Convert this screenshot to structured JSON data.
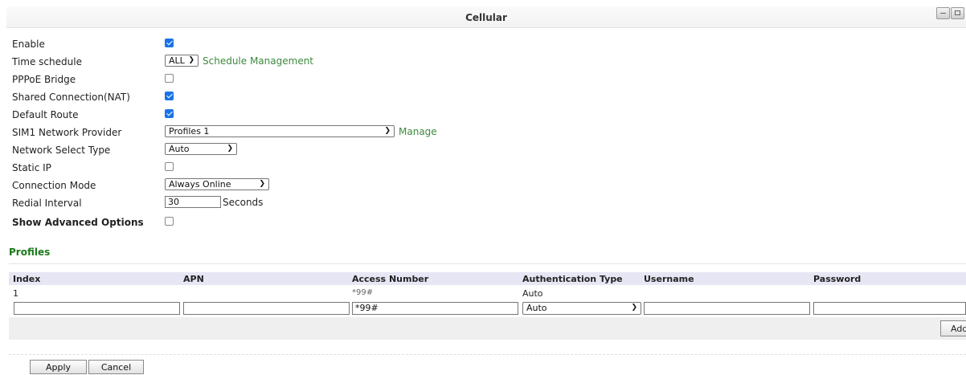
{
  "title": "Cellular",
  "form": {
    "enable_label": "Enable",
    "enable_checked": true,
    "time_schedule_label": "Time schedule",
    "time_schedule_value": "ALL",
    "schedule_management_link": "Schedule Management",
    "pppoe_label": "PPPoE Bridge",
    "pppoe_checked": false,
    "shared_label": "Shared Connection(NAT)",
    "shared_checked": true,
    "default_route_label": "Default Route",
    "default_route_checked": true,
    "sim1_label": "SIM1 Network Provider",
    "sim1_value": "Profiles 1",
    "manage_link": "Manage",
    "net_select_label": "Network Select Type",
    "net_select_value": "Auto",
    "static_ip_label": "Static IP",
    "static_ip_checked": false,
    "conn_mode_label": "Connection Mode",
    "conn_mode_value": "Always Online",
    "redial_label": "Redial Interval",
    "redial_value": "30",
    "redial_unit": "Seconds",
    "advanced_label": "Show Advanced Options",
    "advanced_checked": false
  },
  "profiles": {
    "section_title": "Profiles",
    "columns": [
      "Index",
      "APN",
      "Access Number",
      "Authentication Type",
      "Username",
      "Password"
    ],
    "rows": [
      {
        "index": "1",
        "apn": "",
        "access_number": "*99#",
        "auth": "Auto",
        "username": "",
        "password": ""
      }
    ],
    "new_row": {
      "index": "",
      "apn": "",
      "access_number": "*99#",
      "auth": "Auto",
      "username": "",
      "password": ""
    },
    "add_label": "Add"
  },
  "buttons": {
    "apply": "Apply",
    "cancel": "Cancel"
  },
  "colors": {
    "link": "#3c8a3c",
    "section": "#1b7a1b",
    "header_bg": "#e6e6f4",
    "checkbox": "#1a73e8"
  }
}
